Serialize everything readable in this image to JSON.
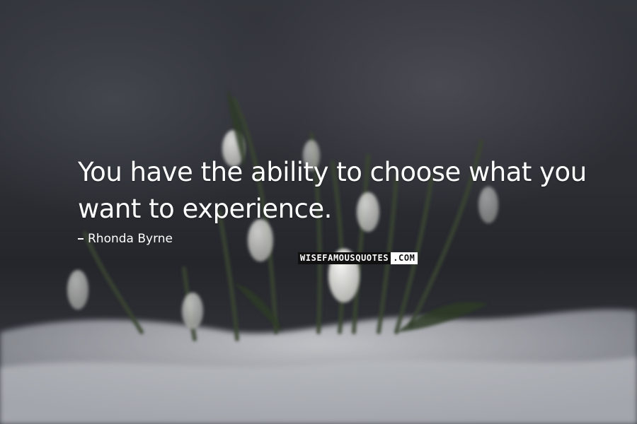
{
  "quote": {
    "line1": "You have the ability to choose what you",
    "line2": "want to experience."
  },
  "author": "Rhonda Byrne",
  "watermark": {
    "dark_part": "WISEFAMOUSQUOTES",
    "light_part": ".COM"
  },
  "scene": {
    "description_colors": {
      "sky": "#34363d",
      "snow": "#c9cbcf",
      "flower": "#e6e6e3",
      "stem": "#3f4a2e"
    }
  }
}
